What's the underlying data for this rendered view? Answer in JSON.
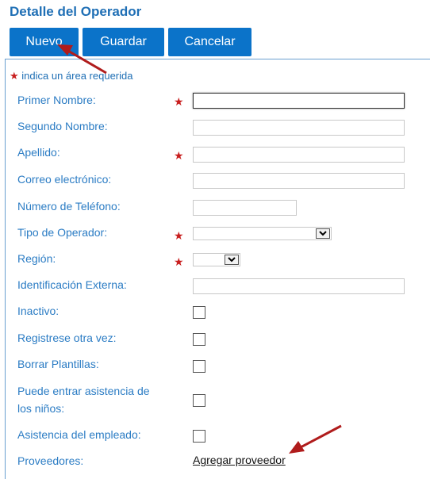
{
  "page": {
    "title": "Detalle del Operador",
    "required_note": "indica un área requerida"
  },
  "toolbar": {
    "new_label": "Nuevo",
    "save_label": "Guardar",
    "cancel_label": "Cancelar"
  },
  "form": {
    "first_name_label": "Primer Nombre:",
    "middle_name_label": "Segundo Nombre:",
    "last_name_label": "Apellido:",
    "email_label": "Correo electrónico:",
    "phone_label": "Número de Teléfono:",
    "operator_type_label": "Tipo de Operador:",
    "region_label": "Región:",
    "external_id_label": "Identificación Externa:",
    "inactive_label": "Inactivo:",
    "register_again_label": "Registrese otra vez:",
    "delete_templates_label": "Borrar Plantillas:",
    "child_attendance_label_line1": "Puede entrar asistencia de",
    "child_attendance_label_line2": "los niños:",
    "employee_attendance_label": "Asistencia del empleado:",
    "providers_label": "Proveedores:",
    "add_provider_link": "Agregar proveedor"
  },
  "colors": {
    "accent": "#0b73c9",
    "label": "#2b7cc4",
    "required_star": "#c81e1e",
    "annotation_arrow": "#b01c1c"
  }
}
